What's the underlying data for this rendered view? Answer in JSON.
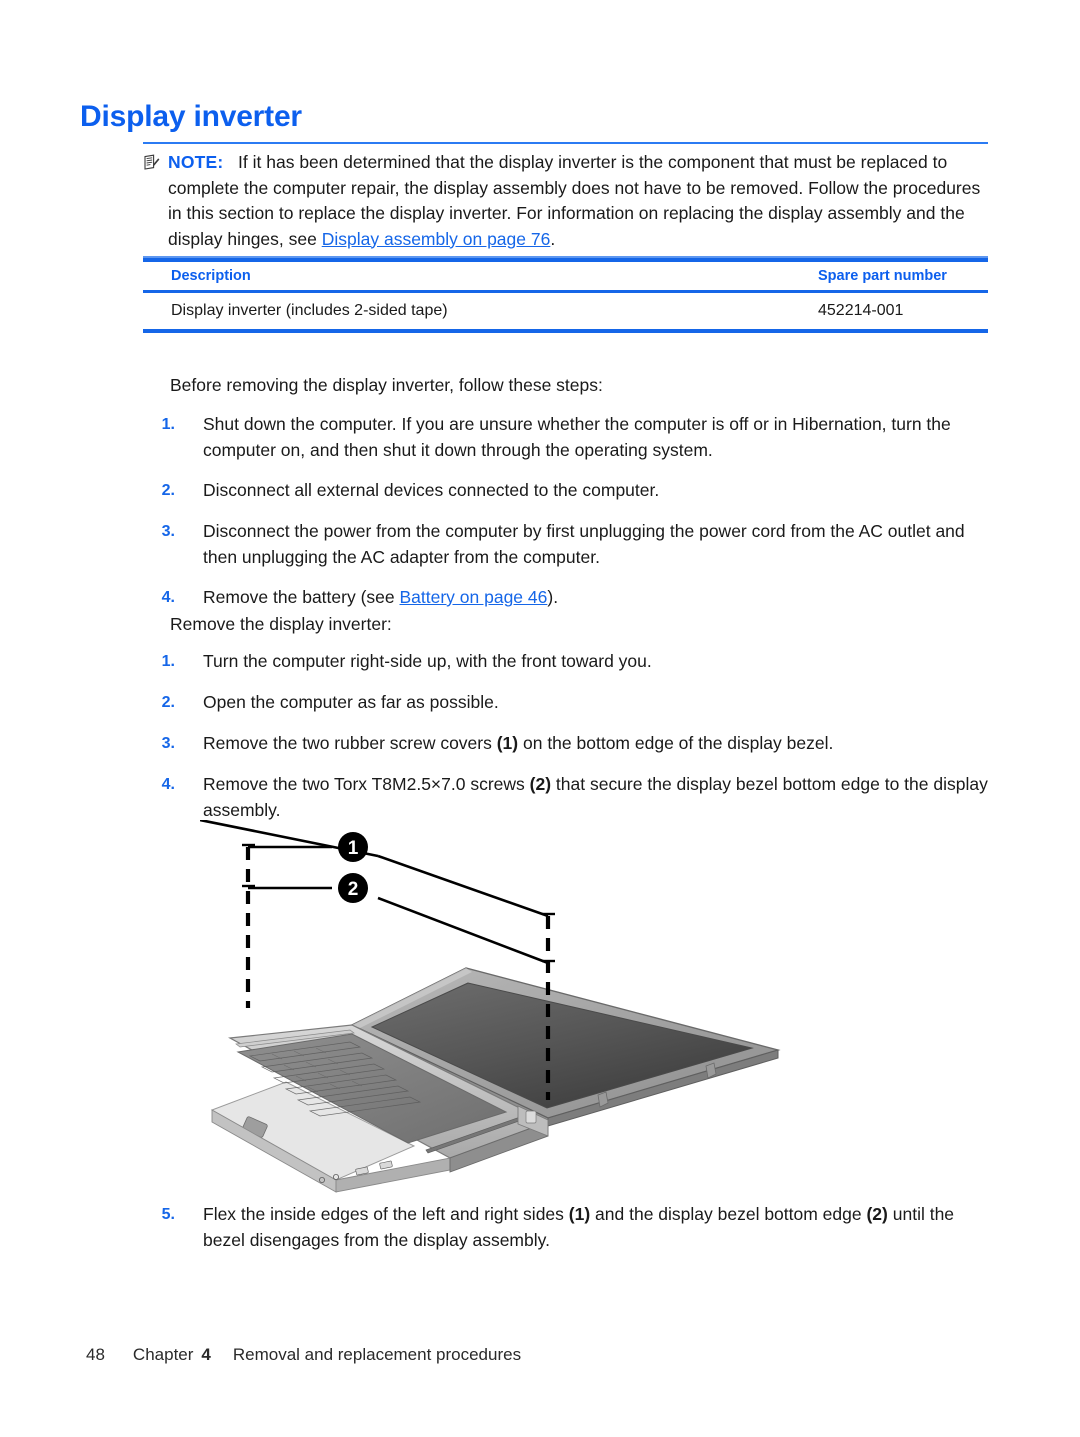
{
  "document": {
    "heading": "Display inverter"
  },
  "note": {
    "icon": "note-pad-icon",
    "label": "NOTE:",
    "text_part1": "If it has been determined that the display inverter is the component that must be replaced to complete the computer repair, the display assembly does not have to be removed. Follow the procedures in this section to replace the display inverter. For information on replacing the display assembly and the display hinges, see ",
    "link_text": "Display assembly on page 76",
    "text_part2": "."
  },
  "parts_table": {
    "columns": [
      "Description",
      "Spare part number"
    ],
    "rows": [
      {
        "description": "Display inverter (includes 2-sided tape)",
        "spare_part_number": "452214-001"
      }
    ]
  },
  "before_section": {
    "intro": "Before removing the display inverter, follow these steps:",
    "steps": [
      {
        "number": "1.",
        "text": "Shut down the computer. If you are unsure whether the computer is off or in Hibernation, turn the computer on, and then shut it down through the operating system."
      },
      {
        "number": "2.",
        "text": "Disconnect all external devices connected to the computer."
      },
      {
        "number": "3.",
        "text": "Disconnect the power from the computer by first unplugging the power cord from the AC outlet and then unplugging the AC adapter from the computer."
      },
      {
        "number": "4.",
        "text_before": "Remove the battery (see ",
        "link_text": "Battery on page 46",
        "text_after": ")."
      }
    ]
  },
  "remove_section": {
    "intro": "Remove the display inverter:",
    "steps": [
      {
        "number": "1.",
        "text": "Turn the computer right-side up, with the front toward you."
      },
      {
        "number": "2.",
        "text": "Open the computer as far as possible."
      },
      {
        "number": "3.",
        "text_before": "Remove the two rubber screw covers ",
        "callout": "(1)",
        "text_after": " on the bottom edge of the display bezel."
      },
      {
        "number": "4.",
        "text_before": "Remove the two Torx T8M2.5×7.0 screws ",
        "callout": "(2)",
        "text_after": " that secure the display bezel bottom edge to the display assembly."
      }
    ]
  },
  "illustration": {
    "caption_alt": "Laptop computer shown open at an angle with dashed callout leader lines",
    "callouts": [
      {
        "label": "1",
        "meaning": "rubber screw covers"
      },
      {
        "label": "2",
        "meaning": "Torx T8M2.5x7.0 screws"
      }
    ]
  },
  "final_step": {
    "number": "5.",
    "text_before": "Flex the inside edges of the left and right sides ",
    "callout1": "(1)",
    "text_mid": " and the display bezel bottom edge ",
    "callout2": "(2)",
    "text_after": " until the bezel disengages from the display assembly."
  },
  "footer": {
    "page_number": "48",
    "chapter_word": "Chapter",
    "chapter_number": "4",
    "chapter_title": "Removal and replacement procedures"
  },
  "colors": {
    "heading_blue": "#0C5FEE",
    "rule_blue": "#1566E8",
    "link_blue": "#1566E8",
    "text_black": "#1a1a1a"
  }
}
